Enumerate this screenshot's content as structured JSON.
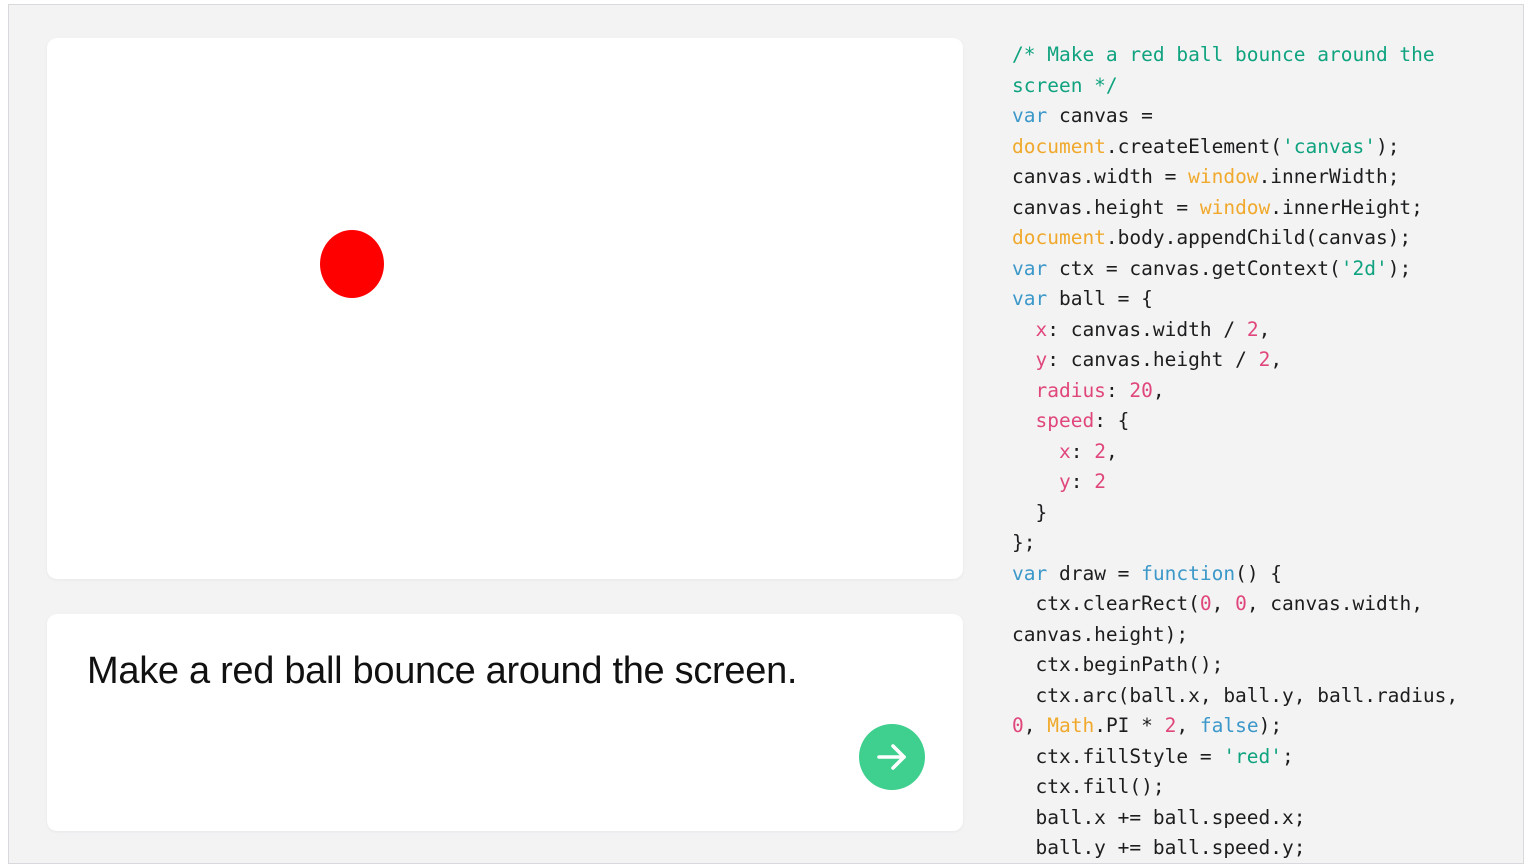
{
  "canvas_preview": {
    "ball_color": "#ff0000"
  },
  "prompt": {
    "text": "Make a red ball bounce around the screen.",
    "submit_icon": "arrow-right-icon",
    "submit_color": "#3fcf8e"
  },
  "colors": {
    "comment": "#10a37f",
    "keyword": "#3b98c9",
    "global": "#f0a92c",
    "string": "#10a37f",
    "number": "#e0467c",
    "property": "#e0467c",
    "plain": "#1d1d1f"
  },
  "code_lines": [
    [
      [
        "comment",
        "/* Make a red ball bounce around the"
      ]
    ],
    [
      [
        "comment",
        "screen */"
      ]
    ],
    [
      [
        "keyword",
        "var"
      ],
      [
        "plain",
        " canvas ="
      ]
    ],
    [
      [
        "global",
        "document"
      ],
      [
        "plain",
        ".createElement("
      ],
      [
        "string",
        "'canvas'"
      ],
      [
        "plain",
        ");"
      ]
    ],
    [
      [
        "plain",
        "canvas.width = "
      ],
      [
        "global",
        "window"
      ],
      [
        "plain",
        ".innerWidth;"
      ]
    ],
    [
      [
        "plain",
        "canvas.height = "
      ],
      [
        "global",
        "window"
      ],
      [
        "plain",
        ".innerHeight;"
      ]
    ],
    [
      [
        "global",
        "document"
      ],
      [
        "plain",
        ".body.appendChild(canvas);"
      ]
    ],
    [
      [
        "keyword",
        "var"
      ],
      [
        "plain",
        " ctx = canvas.getContext("
      ],
      [
        "string",
        "'2d'"
      ],
      [
        "plain",
        ");"
      ]
    ],
    [
      [
        "keyword",
        "var"
      ],
      [
        "plain",
        " ball = {"
      ]
    ],
    [
      [
        "plain",
        "  "
      ],
      [
        "prop",
        "x"
      ],
      [
        "plain",
        ": canvas.width / "
      ],
      [
        "number",
        "2"
      ],
      [
        "plain",
        ","
      ]
    ],
    [
      [
        "plain",
        "  "
      ],
      [
        "prop",
        "y"
      ],
      [
        "plain",
        ": canvas.height / "
      ],
      [
        "number",
        "2"
      ],
      [
        "plain",
        ","
      ]
    ],
    [
      [
        "plain",
        "  "
      ],
      [
        "prop",
        "radius"
      ],
      [
        "plain",
        ": "
      ],
      [
        "number",
        "20"
      ],
      [
        "plain",
        ","
      ]
    ],
    [
      [
        "plain",
        "  "
      ],
      [
        "prop",
        "speed"
      ],
      [
        "plain",
        ": {"
      ]
    ],
    [
      [
        "plain",
        "    "
      ],
      [
        "prop",
        "x"
      ],
      [
        "plain",
        ": "
      ],
      [
        "number",
        "2"
      ],
      [
        "plain",
        ","
      ]
    ],
    [
      [
        "plain",
        "    "
      ],
      [
        "prop",
        "y"
      ],
      [
        "plain",
        ": "
      ],
      [
        "number",
        "2"
      ]
    ],
    [
      [
        "plain",
        "  }"
      ]
    ],
    [
      [
        "plain",
        "};"
      ]
    ],
    [
      [
        "keyword",
        "var"
      ],
      [
        "plain",
        " draw = "
      ],
      [
        "keyword",
        "function"
      ],
      [
        "plain",
        "() {"
      ]
    ],
    [
      [
        "plain",
        "  ctx.clearRect("
      ],
      [
        "number",
        "0"
      ],
      [
        "plain",
        ", "
      ],
      [
        "number",
        "0"
      ],
      [
        "plain",
        ", canvas.width,"
      ]
    ],
    [
      [
        "plain",
        "canvas.height);"
      ]
    ],
    [
      [
        "plain",
        "  ctx.beginPath();"
      ]
    ],
    [
      [
        "plain",
        "  ctx.arc(ball.x, ball.y, ball.radius,"
      ]
    ],
    [
      [
        "number",
        "0"
      ],
      [
        "plain",
        ", "
      ],
      [
        "global",
        "Math"
      ],
      [
        "plain",
        ".PI * "
      ],
      [
        "number",
        "2"
      ],
      [
        "plain",
        ", "
      ],
      [
        "keyword",
        "false"
      ],
      [
        "plain",
        ");"
      ]
    ],
    [
      [
        "plain",
        "  ctx.fillStyle = "
      ],
      [
        "string",
        "'red'"
      ],
      [
        "plain",
        ";"
      ]
    ],
    [
      [
        "plain",
        "  ctx.fill();"
      ]
    ],
    [
      [
        "plain",
        "  ball.x += ball.speed.x;"
      ]
    ],
    [
      [
        "plain",
        "  ball.y += ball.speed.y;"
      ]
    ]
  ]
}
